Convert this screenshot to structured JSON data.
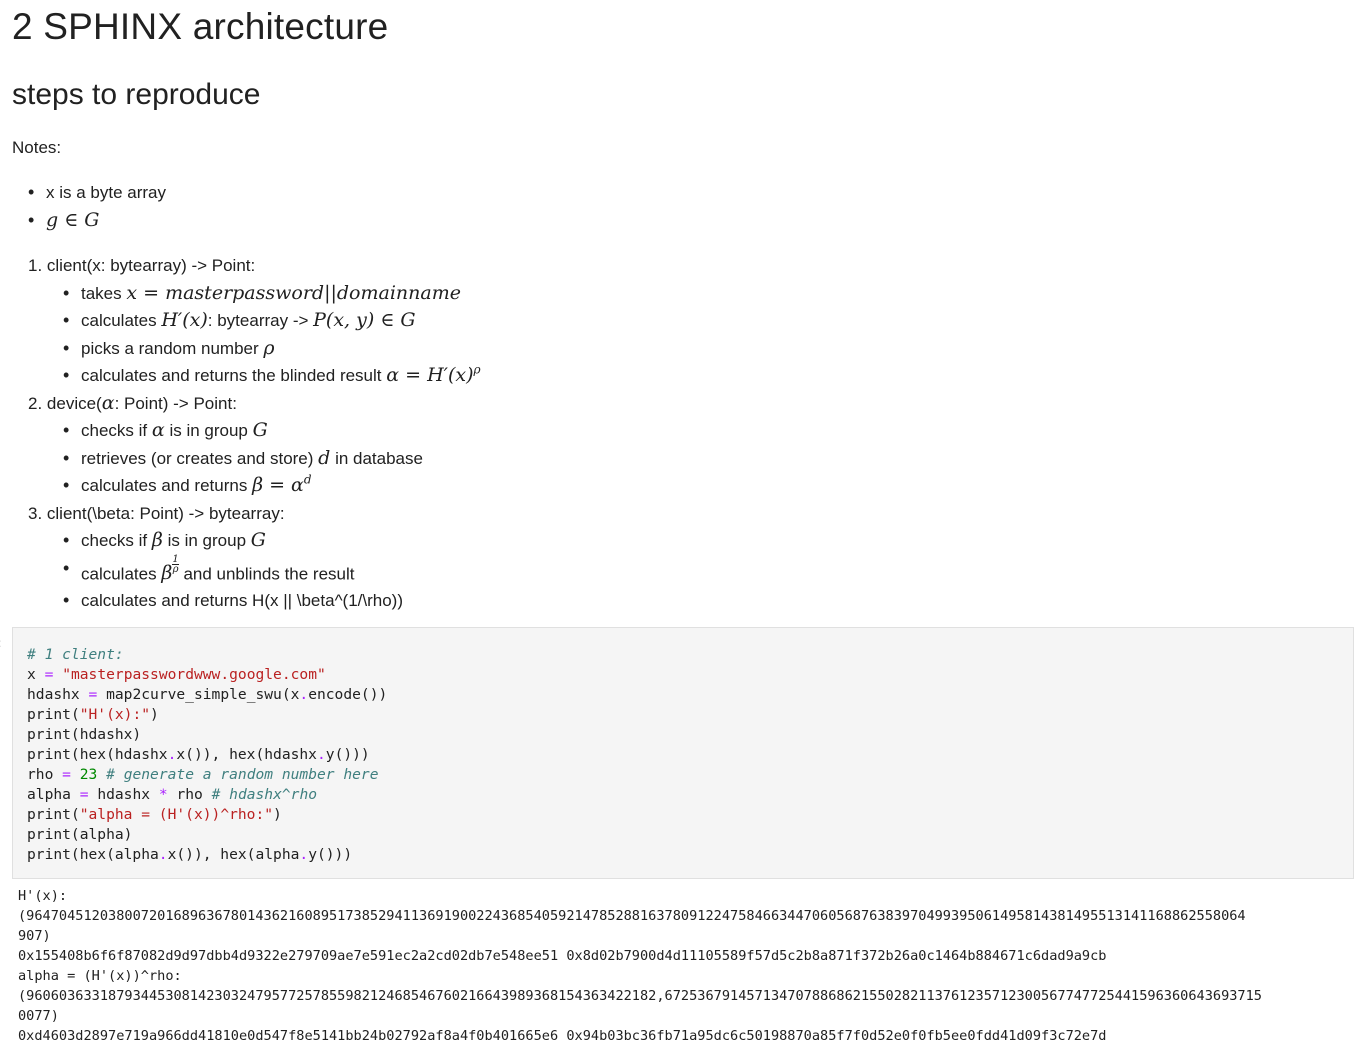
{
  "heading1": "2 SPHINX architecture",
  "heading2": "steps to reproduce",
  "notes_label": "Notes:",
  "bullets": {
    "b1": "x is a byte array",
    "b2_math": "g ∈ G"
  },
  "steps": {
    "s1_title": "client(x: bytearray) -> Point:",
    "s1_a_text": "takes",
    "s1_a_math": "x = masterpassword||domainname",
    "s1_b_text1": "calculates",
    "s1_b_math1": "H′(x)",
    "s1_b_text2": ": bytearray ->",
    "s1_b_math2": "P(x, y) ∈ G",
    "s1_c_text": "picks a random number",
    "s1_c_math": "ρ",
    "s1_d_text": "calculates and returns the blinded result",
    "s1_d_math": "α = H′(x)",
    "s1_d_sup": "ρ",
    "s2_title_pre": "device(",
    "s2_title_math": "α",
    "s2_title_post": ": Point) -> Point:",
    "s2_a_pre": "checks if",
    "s2_a_math": "α",
    "s2_a_mid": "is in group",
    "s2_a_math2": "G",
    "s2_b_pre": "retrieves (or creates and store)",
    "s2_b_math": "d",
    "s2_b_post": "in database",
    "s2_c_text": "calculates and returns",
    "s2_c_math": "β = α",
    "s2_c_sup": "d",
    "s3_title": "client(\\beta: Point) -> bytearray:",
    "s3_a_pre": "checks if",
    "s3_a_math": "β",
    "s3_a_mid": "is in group",
    "s3_a_math2": "G",
    "s3_b_pre": "calculates",
    "s3_b_math": "β",
    "s3_b_num": "1",
    "s3_b_den": "ρ",
    "s3_b_post": "and unblinds the result",
    "s3_c_text": "calculates and returns H(x || \\beta^(1/\\rho))"
  },
  "code": {
    "l1": "# 1 client:",
    "l2_var": "x",
    "l2_str": "\"masterpasswordwww.google.com\"",
    "l3_a": "hdashx",
    "l3_b": "map2curve_simple_swu(x",
    "l3_c": "encode())",
    "l4_fn": "print",
    "l4_str": "\"H'(x):\"",
    "l5": "print(hdashx)",
    "l6_a": "print(hex(hdashx",
    "l6_b": "x()), hex(hdashx",
    "l6_c": "y()))",
    "l7_a": "rho",
    "l7_num": "23",
    "l7_cm": "# generate a random number here",
    "l8_a": "alpha",
    "l8_b": "hdashx",
    "l8_c": "rho",
    "l8_cm": "# hdashx^rho",
    "l9_fn": "print",
    "l9_str": "\"alpha = (H'(x))^rho:\"",
    "l10": "print(alpha)",
    "l11_a": "print(hex(alpha",
    "l11_b": "x()), hex(alpha",
    "l11_c": "y()))"
  },
  "output": {
    "o1": "H'(x):",
    "o2": "(96470451203800720168963678014362160895173852941136919002243685405921478528816378091224758466344706056876383970499395061495814381495513141168862558064",
    "o3": "907)",
    "o4": "0x155408b6f6f87082d9d97dbb4d9322e279709ae7e591ec2a2cd02db7e548ee51 0x8d02b7900d4d11105589f57d5c2b8a871f372b26a0c1464b884671c6dad9a9cb",
    "o5": "alpha = (H'(x))^rho:",
    "o6": "(96060363318793445308142303247957725785598212468546760216643989368154363422182,6725367914571347078868621550282113761235712300567747725441596360643693715",
    "o7": "0077)",
    "o8": "0xd4603d2897e719a966dd41810e0d547f8e5141bb24b02792af8a4f0b401665e6 0x94b03bc36fb71a95dc6c50198870a85f7f0d52e0f0fb5ee0fdd41d09f3c72e7d"
  }
}
